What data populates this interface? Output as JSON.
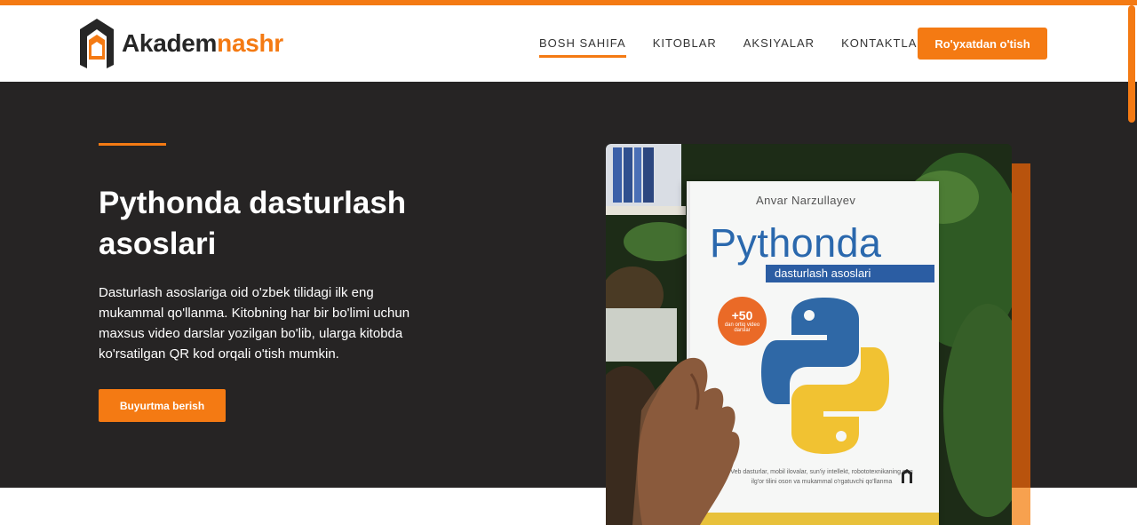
{
  "app": {
    "brand_part1": "Akadem",
    "brand_part2": "nashr",
    "accent_color": "#f47a13",
    "hero_bg": "#262424"
  },
  "nav": {
    "items": [
      {
        "label": "BOSH SAHIFA",
        "active": true
      },
      {
        "label": "KITOBLAR",
        "active": false
      },
      {
        "label": "AKSIYALAR",
        "active": false
      },
      {
        "label": "KONTAKTLAR",
        "active": false
      }
    ],
    "register_label": "Ro'yxatdan o'tish"
  },
  "hero": {
    "title": "Pythonda dasturlash asoslari",
    "description": "Dasturlash asoslariga oid o'zbek tilidagi ilk eng mukammal qo'llanma. Kitobning har bir bo'limi uchun maxsus video darslar yozilgan bo'lib, ularga kitobda ko'rsatilgan QR kod orqali o'tish mumkin.",
    "order_label": "Buyurtma berish"
  },
  "book": {
    "author": "Anvar Narzullayev",
    "title": "Pythonda",
    "subtitle": "dasturlash asoslari",
    "badge_big": "+50",
    "badge_small": "dan ortiq video darslar",
    "blurb": "Veb dasturlar, mobil ilovalar, sun'iy intellekt, robototexnikaning eng ilg'or tilini oson va mukammal o'rgatuvchi qo'llanma"
  }
}
